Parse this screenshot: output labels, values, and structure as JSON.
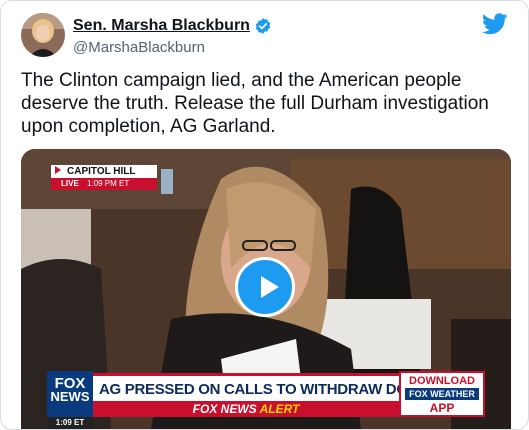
{
  "author": {
    "name": "Sen. Marsha Blackburn",
    "handle": "@MarshaBlackburn",
    "verified_color": "#1d9bf0"
  },
  "brand": {
    "icon": "twitter-bird-icon",
    "color": "#1d9bf0"
  },
  "tweet": {
    "text": "The Clinton campaign lied, and the American people deserve the truth. Release the full Durham investigation upon completion, AG Garland."
  },
  "video": {
    "location_bug": "CAPITOL HILL",
    "live_label": "LIVE",
    "live_time": "1:09 PM ET",
    "network_logo_line1": "FOX",
    "network_logo_line2": "NEWS",
    "network_time": "1:09 ET",
    "headline": "AG PRESSED ON CALLS TO WITHDRAW DOJ SCHOOLS MEMO",
    "alert_prefix": "FOX NEWS",
    "alert_word": "ALERT",
    "promo_line1": "DOWNLOAD",
    "promo_line2": "FOX WEATHER",
    "promo_line3": "APP",
    "play_button": "play-icon"
  }
}
